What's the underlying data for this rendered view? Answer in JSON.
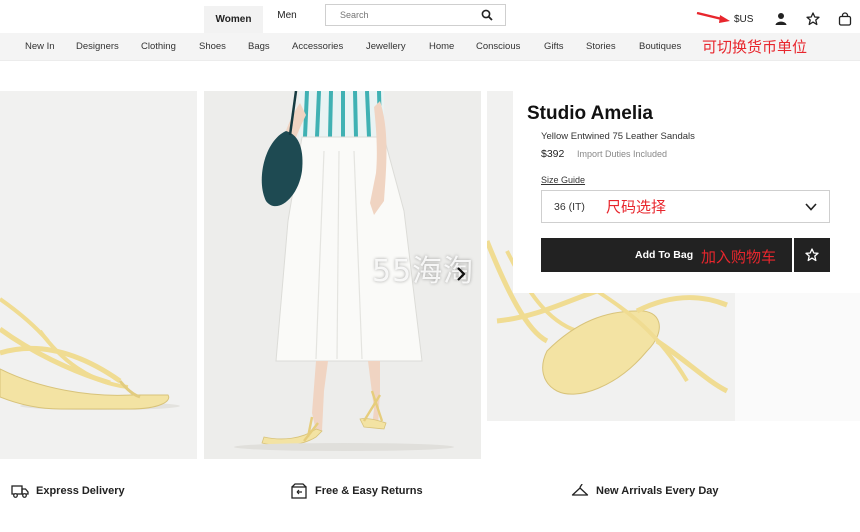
{
  "header": {
    "gender_tabs": [
      {
        "label": "Women",
        "active": true
      },
      {
        "label": "Men",
        "active": false
      }
    ],
    "search_placeholder": "Search",
    "currency": "$US"
  },
  "nav": {
    "items": [
      "New In",
      "Designers",
      "Clothing",
      "Shoes",
      "Bags",
      "Accessories",
      "Jewellery",
      "Home",
      "Conscious",
      "Gifts",
      "Stories",
      "Boutiques"
    ]
  },
  "product": {
    "brand": "Studio Amelia",
    "name": "Yellow Entwined 75 Leather Sandals",
    "price": "$392",
    "duties_note": "Import Duties Included",
    "size_guide_label": "Size Guide",
    "selected_size": "36 (IT)",
    "add_to_bag_label": "Add To Bag"
  },
  "annotations": {
    "currency_note": "可切换货币单位",
    "size_note": "尺码选择",
    "bag_note": "加入购物车",
    "watermark": "55海淘"
  },
  "features": [
    {
      "label": "Express Delivery",
      "icon": "truck-icon"
    },
    {
      "label": "Free & Easy Returns",
      "icon": "return-box-icon"
    },
    {
      "label": "New Arrivals Every Day",
      "icon": "hanger-icon"
    }
  ],
  "colors": {
    "accent_dark": "#222222",
    "annotation_red": "#e8262d",
    "nav_bg": "#f4f4f4",
    "sandal_yellow": "#f3e3a3"
  }
}
